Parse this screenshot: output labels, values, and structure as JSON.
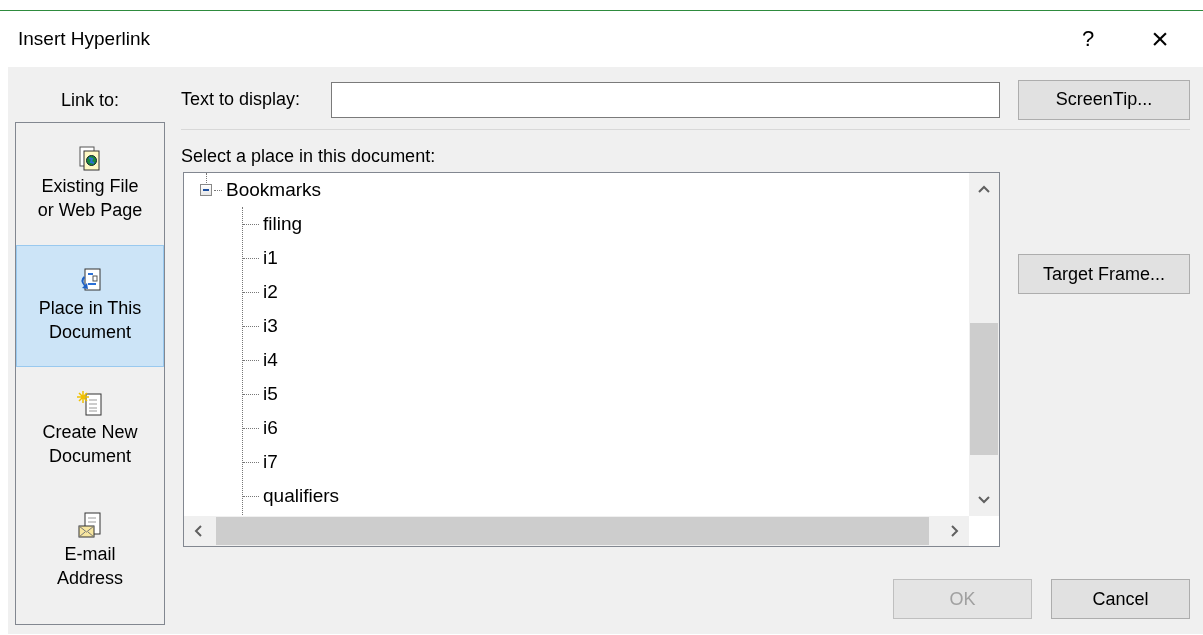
{
  "window": {
    "title": "Insert Hyperlink",
    "help_button": "?",
    "close_button": "×"
  },
  "link_to": {
    "label": "Link to:",
    "items": [
      {
        "kind": "file-web",
        "lines": [
          "Existing File",
          "or Web Page"
        ],
        "selected": false
      },
      {
        "kind": "place",
        "lines": [
          "Place in This",
          "Document"
        ],
        "selected": true
      },
      {
        "kind": "new-doc",
        "lines": [
          "Create New",
          "Document"
        ],
        "selected": false
      },
      {
        "kind": "email",
        "lines": [
          "E-mail",
          "Address"
        ],
        "selected": false
      }
    ]
  },
  "text_to_display": {
    "label": "Text to display:"
  },
  "screen_tip_button": {
    "label": "ScreenTip...",
    "disabled": false
  },
  "place_list": {
    "label": "Select a place in this document:",
    "items": [
      {
        "label": "Bookmarks",
        "expanded": true,
        "children": [
          {
            "label": "filing"
          },
          {
            "label": "i1"
          },
          {
            "label": "i2"
          },
          {
            "label": "i3"
          },
          {
            "label": "i4"
          },
          {
            "label": "i5"
          },
          {
            "label": "i6"
          },
          {
            "label": "i7"
          },
          {
            "label": "qualifiers"
          }
        ]
      }
    ]
  },
  "target_frame_button": {
    "label": "Target Frame...",
    "disabled": false
  },
  "ok_button": {
    "label": "OK",
    "disabled": true
  },
  "cancel_button": {
    "label": "Cancel",
    "disabled": false
  }
}
